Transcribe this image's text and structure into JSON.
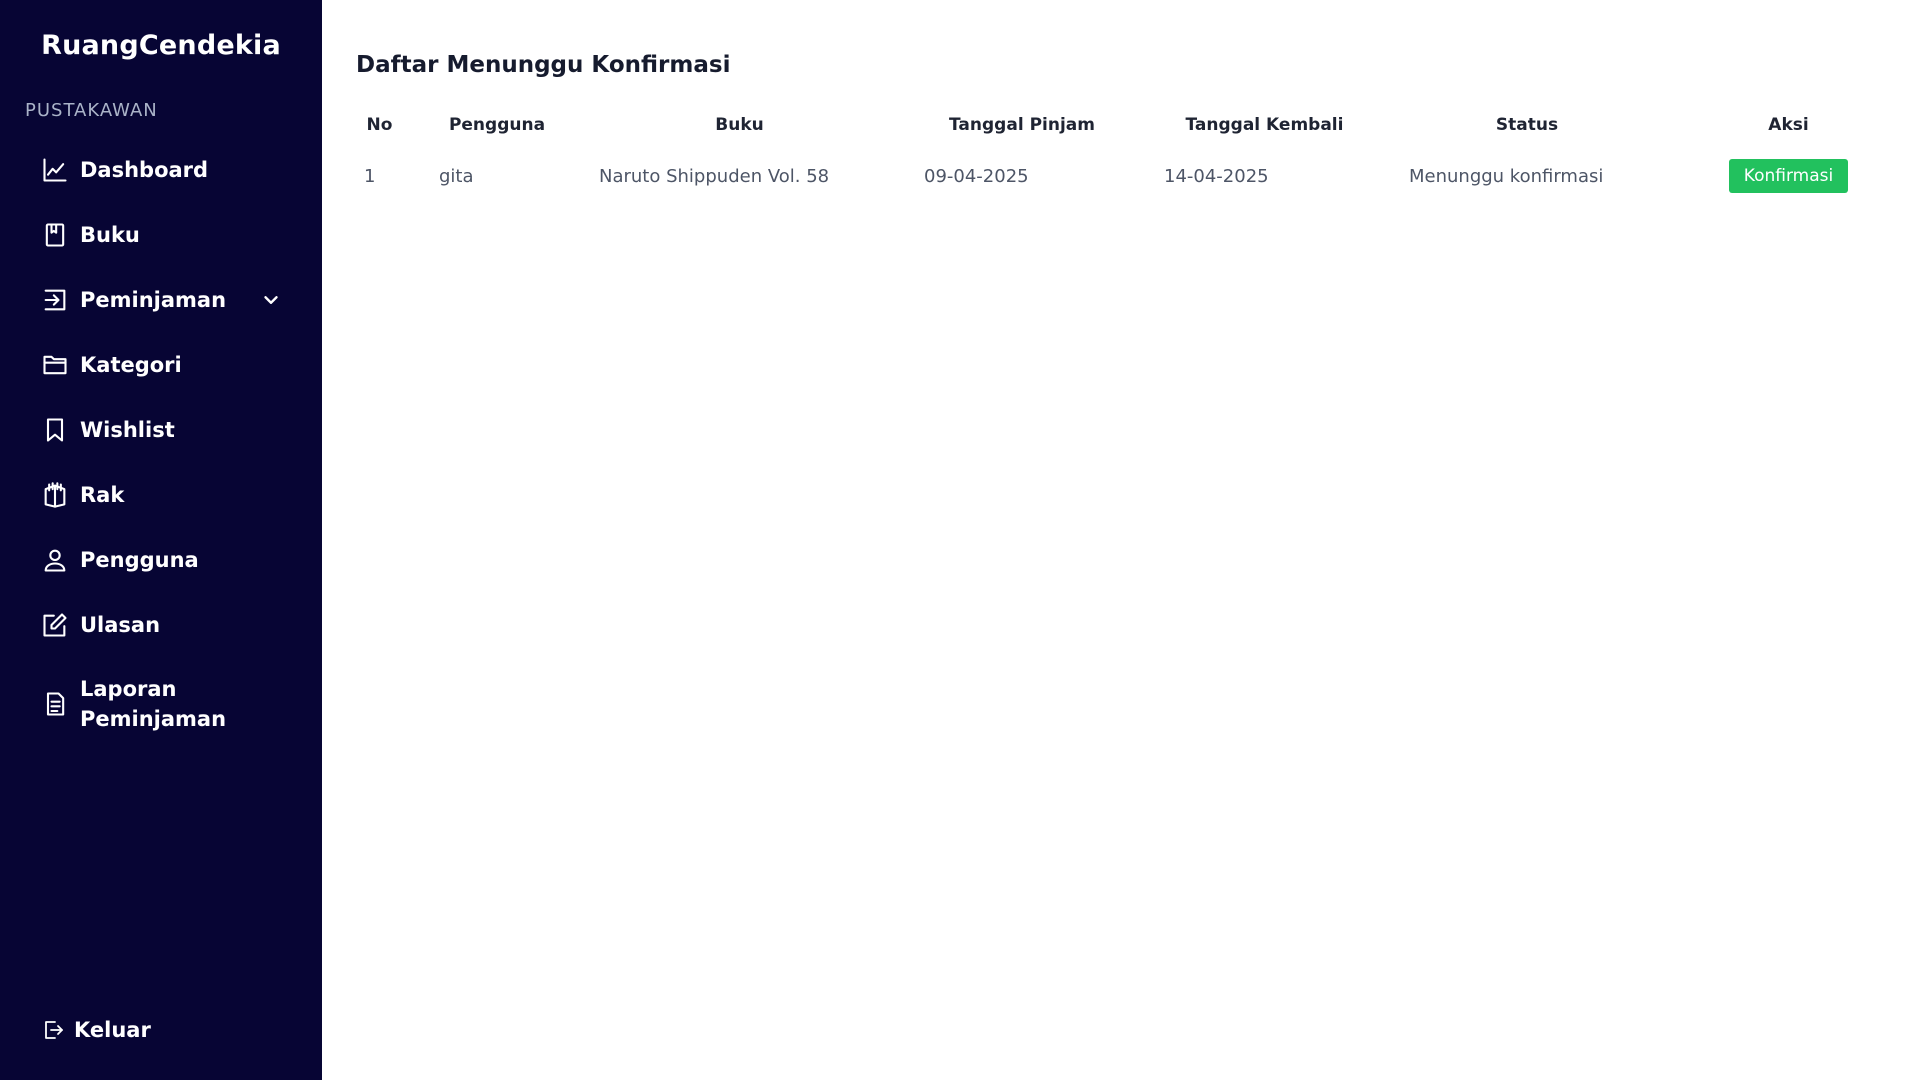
{
  "app": {
    "brand": "RuangCendekia",
    "role_label": "PUSTAKAWAN"
  },
  "sidebar": {
    "items": [
      {
        "label": "Dashboard",
        "icon": "chart-line-icon"
      },
      {
        "label": "Buku",
        "icon": "book-icon"
      },
      {
        "label": "Peminjaman",
        "icon": "login-arrow-icon",
        "has_dropdown": true,
        "dropdown_icon": "chevron-down-icon"
      },
      {
        "label": "Kategori",
        "icon": "folder-icon"
      },
      {
        "label": "Wishlist",
        "icon": "bookmark-icon"
      },
      {
        "label": "Rak",
        "icon": "bookshelf-icon"
      },
      {
        "label": "Pengguna",
        "icon": "user-icon"
      },
      {
        "label": "Ulasan",
        "icon": "edit-icon"
      },
      {
        "label": "Laporan Peminjaman",
        "icon": "document-icon"
      }
    ],
    "logout_label": "Keluar",
    "logout_icon": "logout-icon",
    "background_color": "#070534"
  },
  "main": {
    "title": "Daftar Menunggu Konfirmasi",
    "table": {
      "columns": [
        "No",
        "Pengguna",
        "Buku",
        "Tanggal Pinjam",
        "Tanggal Kembali",
        "Status",
        "Aksi"
      ],
      "rows": [
        {
          "no": "1",
          "user": "gita",
          "book": "Naruto Shippuden Vol. 58",
          "borrow_date": "09-04-2025",
          "return_date": "14-04-2025",
          "status": "Menunggu konfirmasi",
          "action_label": "Konfirmasi"
        }
      ]
    },
    "accent_color": "#22c15e"
  }
}
